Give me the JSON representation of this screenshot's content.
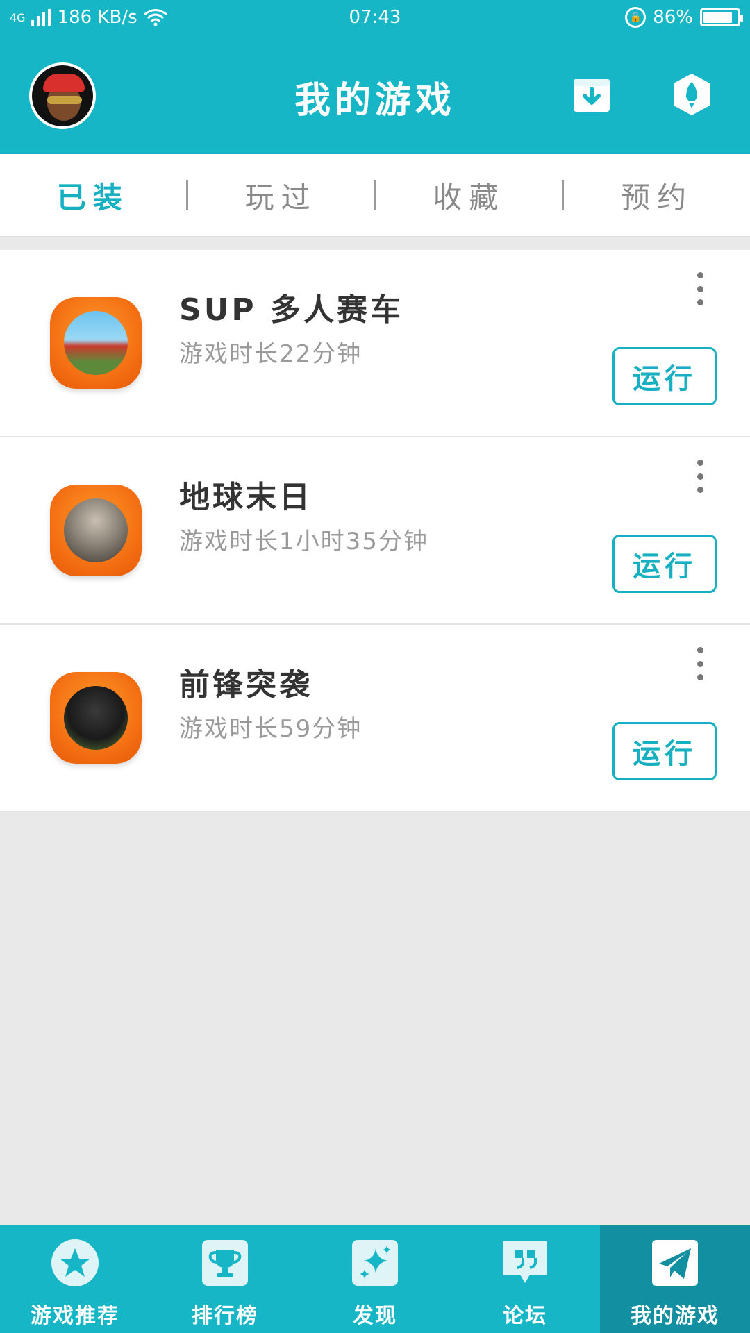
{
  "status_bar": {
    "network": "4G",
    "speed": "186 KB/s",
    "time": "07:43",
    "battery": "86%",
    "battery_level": 0.86
  },
  "header": {
    "title": "我的游戏"
  },
  "tabs": [
    {
      "label": "已装",
      "active": true
    },
    {
      "label": "玩过",
      "active": false
    },
    {
      "label": "收藏",
      "active": false
    },
    {
      "label": "预约",
      "active": false
    }
  ],
  "games": [
    {
      "name": "SUP 多人赛车",
      "playtime": "游戏时长22分钟",
      "run_label": "运行"
    },
    {
      "name": "地球末日",
      "playtime": "游戏时长1小时35分钟",
      "run_label": "运行"
    },
    {
      "name": "前锋突袭",
      "playtime": "游戏时长59分钟",
      "run_label": "运行"
    }
  ],
  "bottom_nav": [
    {
      "label": "游戏推荐",
      "icon": "star-icon",
      "active": false
    },
    {
      "label": "排行榜",
      "icon": "trophy-icon",
      "active": false
    },
    {
      "label": "发现",
      "icon": "sparkle-icon",
      "active": false
    },
    {
      "label": "论坛",
      "icon": "quote-icon",
      "active": false
    },
    {
      "label": "我的游戏",
      "icon": "paper-plane-icon",
      "active": true
    }
  ],
  "colors": {
    "primary": "#16b6c6",
    "active_nav": "#128fa0",
    "accent_text": "#16b0c2"
  }
}
